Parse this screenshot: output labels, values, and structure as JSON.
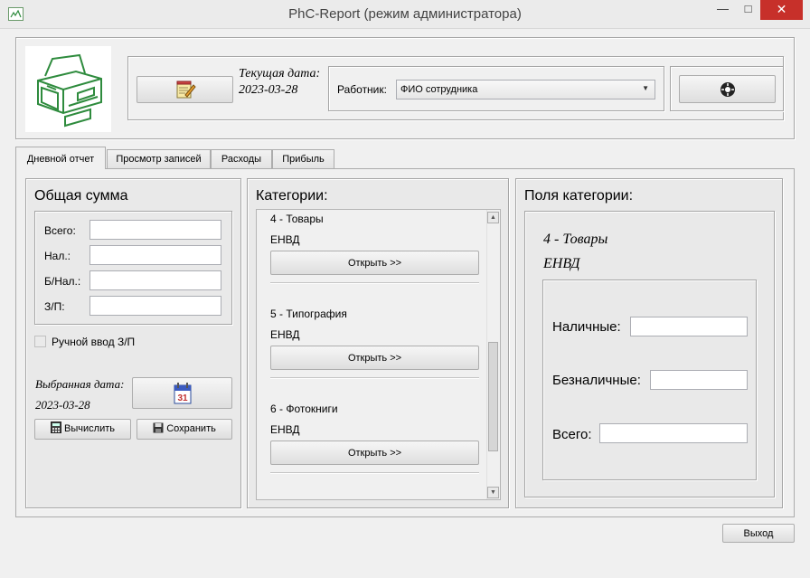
{
  "window": {
    "title": "PhC-Report (режим администратора)",
    "minimize_glyph": "—",
    "maximize_glyph": "□",
    "close_glyph": "✕"
  },
  "header": {
    "current_date_label": "Текущая дата:",
    "current_date": "2023-03-28",
    "worker_label": "Работник:",
    "worker_value": "ФИО сотрудника"
  },
  "tabs": [
    {
      "label": "Дневной отчет",
      "active": true
    },
    {
      "label": "Просмотр записей",
      "active": false
    },
    {
      "label": "Расходы",
      "active": false
    },
    {
      "label": "Прибыль",
      "active": false
    }
  ],
  "totals": {
    "title": "Общая сумма",
    "fields": [
      {
        "label": "Всего:",
        "value": ""
      },
      {
        "label": "Нал.:",
        "value": ""
      },
      {
        "label": "Б/Нал.:",
        "value": ""
      },
      {
        "label": "З/П:",
        "value": ""
      }
    ],
    "manual_checkbox_label": "Ручной ввод З/П",
    "manual_checked": false,
    "selected_date_label": "Выбранная дата:",
    "selected_date": "2023-03-28",
    "calc_button": "Вычислить",
    "save_button": "Сохранить",
    "calendar_day": "31"
  },
  "categories": {
    "title": "Категории:",
    "items": [
      {
        "name": "4 - Товары",
        "tax": "ЕНВД",
        "open_label": "Открыть >>"
      },
      {
        "name": "5 - Типография",
        "tax": "ЕНВД",
        "open_label": "Открыть >>"
      },
      {
        "name": "6 - Фотокниги",
        "tax": "ЕНВД",
        "open_label": "Открыть >>"
      }
    ],
    "scroll_up": "▲",
    "scroll_down": "▼"
  },
  "fields_panel": {
    "title": "Поля категории:",
    "category_name": "4 - Товары",
    "category_tax": "ЕНВД",
    "cash_label": "Наличные:",
    "cashless_label": "Безналичные:",
    "total_label": "Всего:",
    "cash_value": "",
    "cashless_value": "",
    "total_value": ""
  },
  "footer": {
    "exit_button": "Выход"
  },
  "colors": {
    "close_button": "#c7302a",
    "printer_logo": "#2e8b3d"
  }
}
